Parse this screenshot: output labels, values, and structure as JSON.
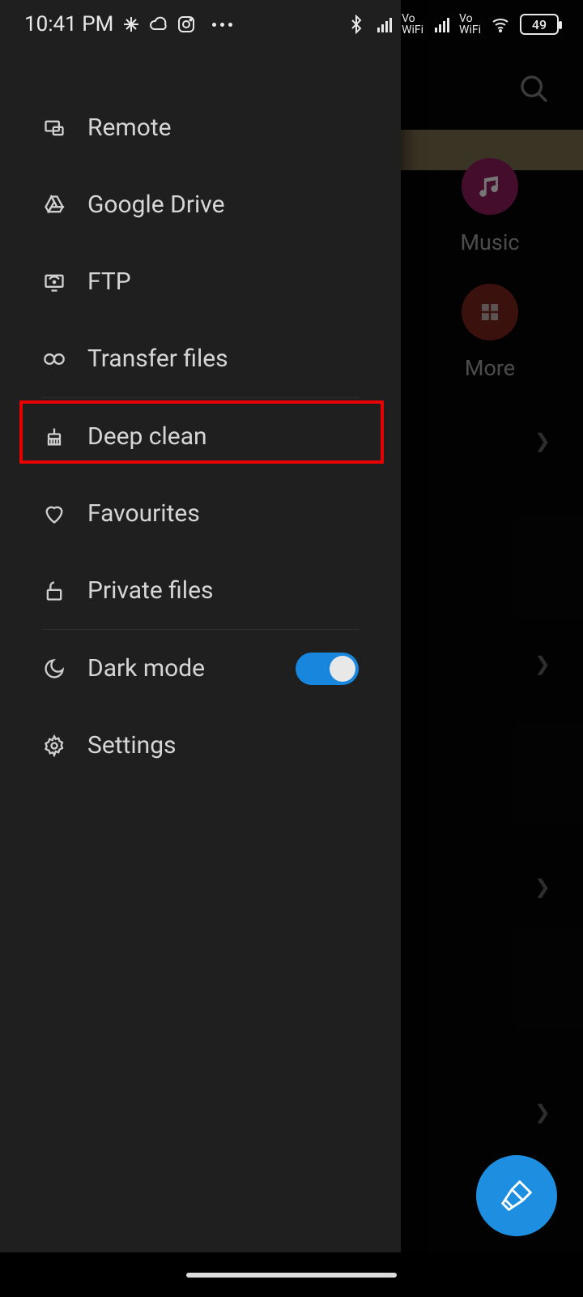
{
  "statusbar": {
    "time": "10:41 PM",
    "battery": "49"
  },
  "background": {
    "shortcuts": {
      "music_label": "Music",
      "more_label": "More"
    }
  },
  "drawer": {
    "items": {
      "remote": {
        "label": "Remote"
      },
      "google_drive": {
        "label": "Google Drive"
      },
      "ftp": {
        "label": "FTP"
      },
      "transfer": {
        "label": "Transfer files"
      },
      "deep_clean": {
        "label": "Deep clean"
      },
      "favourites": {
        "label": "Favourites"
      },
      "private_files": {
        "label": "Private files"
      },
      "dark_mode": {
        "label": "Dark mode",
        "enabled": true
      },
      "settings": {
        "label": "Settings"
      }
    }
  }
}
